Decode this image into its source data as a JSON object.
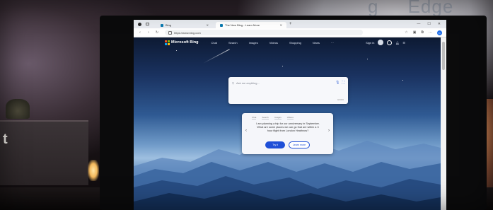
{
  "browser": {
    "tabs": [
      {
        "label": "Bing",
        "active": false
      },
      {
        "label": "The New Bing - Learn More",
        "active": true
      }
    ],
    "new_tab_symbol": "+",
    "window_controls": [
      "—",
      "☐",
      "✕"
    ],
    "nav": {
      "back": "‹",
      "forward": "›",
      "refresh": "↻"
    },
    "address": "https://www.bing.com",
    "toolbar_icons": [
      "star-icon",
      "collections-icon",
      "extensions-icon",
      "settings-icon",
      "bing-chat-icon"
    ]
  },
  "page": {
    "logo_text": "Microsoft Bing",
    "nav_links": [
      "Chat",
      "Search",
      "Images",
      "Videos",
      "Shopping",
      "News",
      "···"
    ],
    "header_right": {
      "user_label": "Sign in"
    },
    "search": {
      "placeholder": "Ask me anything...",
      "char_count": "0/2000"
    },
    "chat_card": {
      "tabs": [
        "Chat",
        "Search",
        "Images",
        "Videos"
      ],
      "prompt": "I am planning a trip for our anniversary in September. What are some places we can go that are within a 3 hour flight from London Heathrow?",
      "try_label": "Try it",
      "learn_label": "Learn more"
    }
  },
  "colors": {
    "accent": "#1e4fd7",
    "sky_top": "#0d1a33",
    "sky_mid": "#2f5a93",
    "horizon": "#9ebfe0"
  }
}
